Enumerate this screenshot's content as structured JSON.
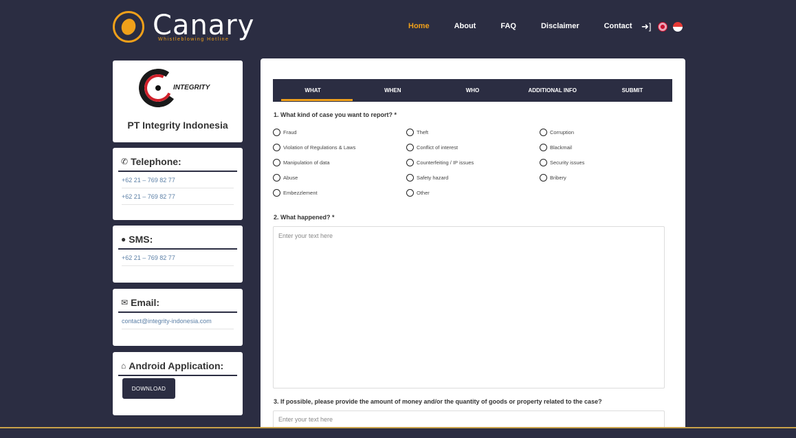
{
  "brand": {
    "name": "Canary",
    "tagline": "Whistleblowing Hotline",
    "accent": "#f0a01a",
    "bg": "#2b2d42"
  },
  "nav": {
    "items": [
      "Home",
      "About",
      "FAQ",
      "Disclaimer",
      "Contact"
    ],
    "active": "Home"
  },
  "sidebar": {
    "company_logo_text": "INTEGRITY",
    "company": "PT Integrity Indonesia",
    "telephone": {
      "title": "Telephone:",
      "numbers": [
        "+62 21 – 769 82 77",
        "+62 21 – 769 82 77"
      ]
    },
    "sms": {
      "title": "SMS:",
      "numbers": [
        "+62 21 – 769 82 77"
      ]
    },
    "email": {
      "title": "Email:",
      "address": "contact@integrity-indonesia.com"
    },
    "android": {
      "title": "Android Application:",
      "button": "DOWNLOAD"
    }
  },
  "steps": [
    "WHAT",
    "WHEN",
    "WHO",
    "ADDITIONAL INFO",
    "SUBMIT"
  ],
  "form": {
    "q1": "1. What kind of case you want to report? *",
    "options": [
      "Fraud",
      "Theft",
      "Corruption",
      "Violation of Regulations & Laws",
      "Conflict of interest",
      "Blackmail",
      "Manipulation of data",
      "Counterfeiting / IP issues",
      "Security issues",
      "Abuse",
      "Safety hazard",
      "Bribery",
      "Embezzlement",
      "Other"
    ],
    "q2": "2. What happened? *",
    "q2_placeholder": "Enter your text here",
    "q3": "3. If possible, please provide the amount of money and/or the quantity of goods or property related to the case?",
    "q3_placeholder": "Enter your text here"
  }
}
